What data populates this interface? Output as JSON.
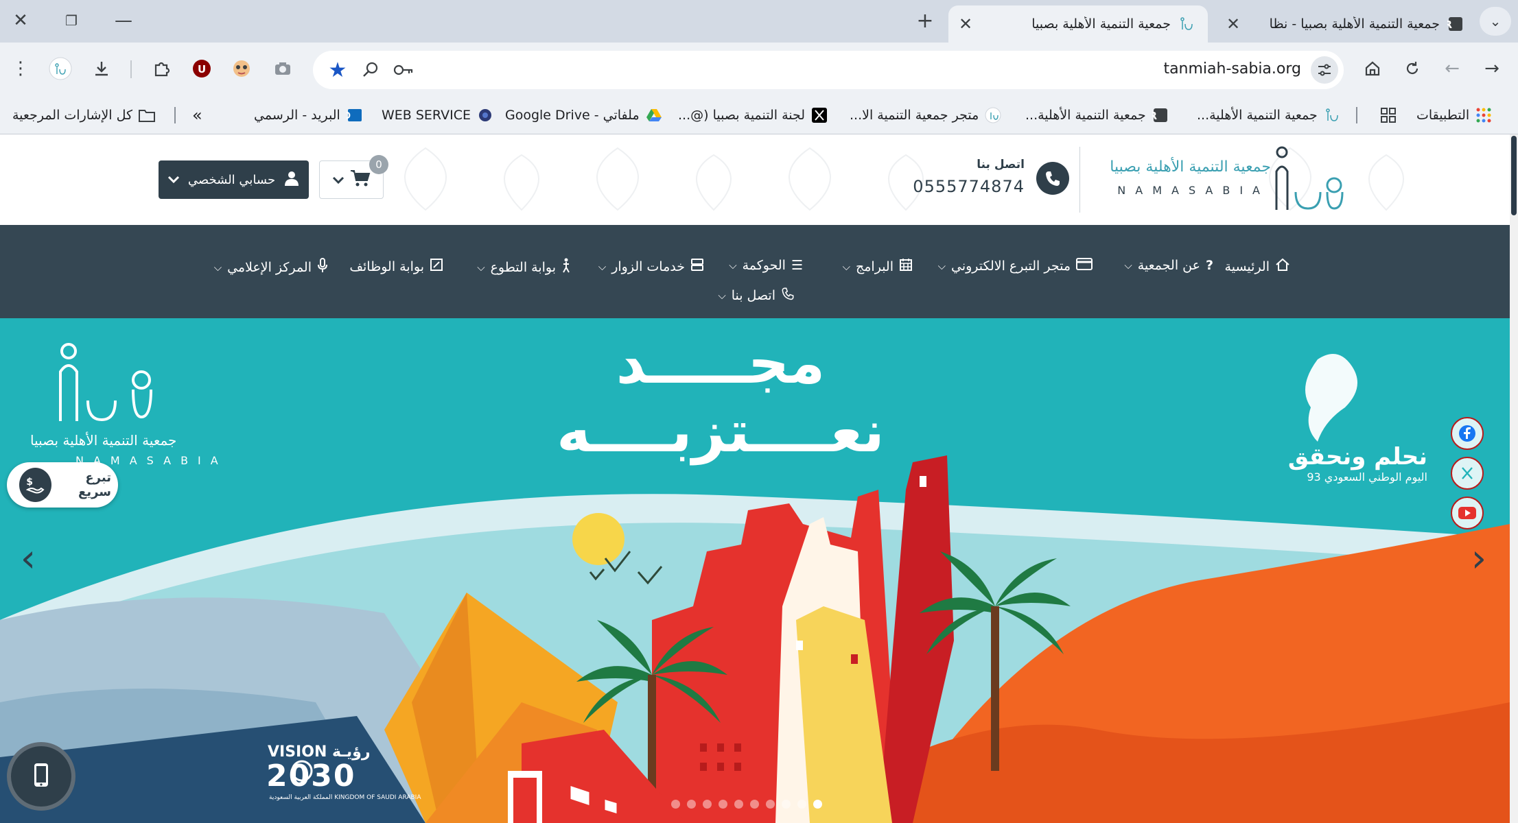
{
  "browser": {
    "tabs": [
      {
        "title": "جمعية التنمية الأهلية بصبيا - نظا",
        "active": false
      },
      {
        "title": "جمعية التنمية الأهلية بصبيا",
        "active": true
      }
    ],
    "address_bar": {
      "url": "tanmiah-sabia.org"
    },
    "bookmarks": [
      {
        "label": "التطبيقات",
        "icon": "apps-grid-icon"
      },
      {
        "label": "جمعية التنمية الأهلية...",
        "icon": "site-logo-icon"
      },
      {
        "label": "جمعية التنمية الأهلية...",
        "icon": "r-logo-icon"
      },
      {
        "label": "متجر جمعية التنمية الا...",
        "icon": "site-logo-icon"
      },
      {
        "label": "لجنة التنمية بصبيا (@...",
        "icon": "x-logo-icon"
      },
      {
        "label": "ملفاتي - Google Drive",
        "icon": "google-drive-icon"
      },
      {
        "label": "WEB SERVICE",
        "icon": "globe-icon"
      },
      {
        "label": "البريد - الرسمي",
        "icon": "outlook-icon"
      },
      {
        "label": "كل الإشارات المرجعية",
        "icon": "folder-icon"
      }
    ]
  },
  "header": {
    "logo_text_ar": "جمعية التنمية الأهلية بصبيا",
    "logo_text_en": "NAMASABIA",
    "contact_label": "اتصل بنا",
    "contact_phone": "0555774874",
    "cart_count": "0",
    "account_label": "حسابي الشخصي"
  },
  "nav": {
    "items": [
      {
        "label": "الرئيسية",
        "icon": "home-icon",
        "has_dropdown": false
      },
      {
        "label": "عن الجمعية",
        "icon": "question-icon",
        "has_dropdown": true
      },
      {
        "label": "متجر التبرع الالكتروني",
        "icon": "card-icon",
        "has_dropdown": true
      },
      {
        "label": "البرامج",
        "icon": "calendar-icon",
        "has_dropdown": true
      },
      {
        "label": "الحوكمة",
        "icon": "list-icon",
        "has_dropdown": true
      },
      {
        "label": "خدمات الزوار",
        "icon": "server-icon",
        "has_dropdown": true
      },
      {
        "label": "بوابة التطوع",
        "icon": "person-icon",
        "has_dropdown": true
      },
      {
        "label": "بوابة الوظائف",
        "icon": "edit-icon",
        "has_dropdown": false
      },
      {
        "label": "المركز الإعلامي",
        "icon": "microphone-icon",
        "has_dropdown": true
      },
      {
        "label": "اتصل بنا",
        "icon": "phone-icon",
        "has_dropdown": true
      }
    ]
  },
  "hero": {
    "headline_line1": "مجـــــد",
    "headline_line2": "نعــــتزبــــه",
    "slogan": "نحلم ونحقق",
    "slogan_sub": "اليوم الوطني السعودي 93",
    "hero_logo_ar": "جمعية التنمية الأهلية بصبيا",
    "hero_logo_en": "NAMASABIA",
    "vision_label": "VISION رؤيـة",
    "vision_year": "2030",
    "vision_sub": "المملكة العربية السعودية KINGDOM OF SAUDI ARABIA",
    "slide_count": 10,
    "active_slide": 10,
    "quick_donate_label": "تبرع سريع"
  },
  "colors": {
    "brand_dark": "#2f3f4a",
    "nav_bg": "#354753",
    "hero_teal": "#21b3b9",
    "accent_red": "#d32f2f",
    "accent_orange": "#f26522"
  }
}
